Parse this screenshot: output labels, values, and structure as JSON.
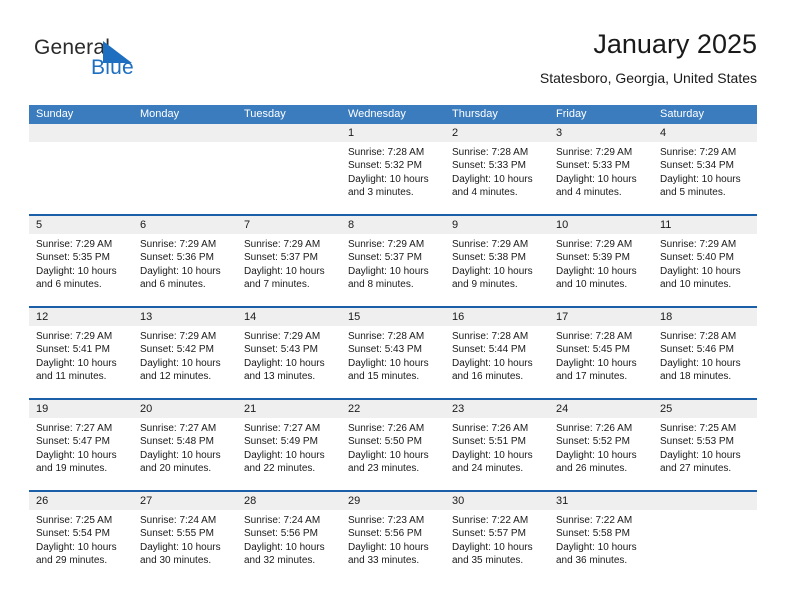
{
  "brand": {
    "name_part1": "General",
    "name_part2": "Blue",
    "triangle_color": "#1f6fc0",
    "text_color": "#2b2b2b"
  },
  "header": {
    "title": "January 2025",
    "subtitle": "Statesboro, Georgia, United States"
  },
  "theme": {
    "header_bar": "#3b7cbe",
    "row_divider": "#1b5fa8",
    "date_band": "#efefef",
    "text": "#1a1a1a"
  },
  "weekdays": [
    "Sunday",
    "Monday",
    "Tuesday",
    "Wednesday",
    "Thursday",
    "Friday",
    "Saturday"
  ],
  "weeks": [
    [
      {
        "day": "",
        "sunrise": "",
        "sunset": "",
        "daylight": "",
        "daylight2": "",
        "empty": true
      },
      {
        "day": "",
        "sunrise": "",
        "sunset": "",
        "daylight": "",
        "daylight2": "",
        "empty": true
      },
      {
        "day": "",
        "sunrise": "",
        "sunset": "",
        "daylight": "",
        "daylight2": "",
        "empty": true
      },
      {
        "day": "1",
        "sunrise": "Sunrise: 7:28 AM",
        "sunset": "Sunset: 5:32 PM",
        "daylight": "Daylight: 10 hours",
        "daylight2": "and 3 minutes.",
        "empty": false
      },
      {
        "day": "2",
        "sunrise": "Sunrise: 7:28 AM",
        "sunset": "Sunset: 5:33 PM",
        "daylight": "Daylight: 10 hours",
        "daylight2": "and 4 minutes.",
        "empty": false
      },
      {
        "day": "3",
        "sunrise": "Sunrise: 7:29 AM",
        "sunset": "Sunset: 5:33 PM",
        "daylight": "Daylight: 10 hours",
        "daylight2": "and 4 minutes.",
        "empty": false
      },
      {
        "day": "4",
        "sunrise": "Sunrise: 7:29 AM",
        "sunset": "Sunset: 5:34 PM",
        "daylight": "Daylight: 10 hours",
        "daylight2": "and 5 minutes.",
        "empty": false
      }
    ],
    [
      {
        "day": "5",
        "sunrise": "Sunrise: 7:29 AM",
        "sunset": "Sunset: 5:35 PM",
        "daylight": "Daylight: 10 hours",
        "daylight2": "and 6 minutes.",
        "empty": false
      },
      {
        "day": "6",
        "sunrise": "Sunrise: 7:29 AM",
        "sunset": "Sunset: 5:36 PM",
        "daylight": "Daylight: 10 hours",
        "daylight2": "and 6 minutes.",
        "empty": false
      },
      {
        "day": "7",
        "sunrise": "Sunrise: 7:29 AM",
        "sunset": "Sunset: 5:37 PM",
        "daylight": "Daylight: 10 hours",
        "daylight2": "and 7 minutes.",
        "empty": false
      },
      {
        "day": "8",
        "sunrise": "Sunrise: 7:29 AM",
        "sunset": "Sunset: 5:37 PM",
        "daylight": "Daylight: 10 hours",
        "daylight2": "and 8 minutes.",
        "empty": false
      },
      {
        "day": "9",
        "sunrise": "Sunrise: 7:29 AM",
        "sunset": "Sunset: 5:38 PM",
        "daylight": "Daylight: 10 hours",
        "daylight2": "and 9 minutes.",
        "empty": false
      },
      {
        "day": "10",
        "sunrise": "Sunrise: 7:29 AM",
        "sunset": "Sunset: 5:39 PM",
        "daylight": "Daylight: 10 hours",
        "daylight2": "and 10 minutes.",
        "empty": false
      },
      {
        "day": "11",
        "sunrise": "Sunrise: 7:29 AM",
        "sunset": "Sunset: 5:40 PM",
        "daylight": "Daylight: 10 hours",
        "daylight2": "and 10 minutes.",
        "empty": false
      }
    ],
    [
      {
        "day": "12",
        "sunrise": "Sunrise: 7:29 AM",
        "sunset": "Sunset: 5:41 PM",
        "daylight": "Daylight: 10 hours",
        "daylight2": "and 11 minutes.",
        "empty": false
      },
      {
        "day": "13",
        "sunrise": "Sunrise: 7:29 AM",
        "sunset": "Sunset: 5:42 PM",
        "daylight": "Daylight: 10 hours",
        "daylight2": "and 12 minutes.",
        "empty": false
      },
      {
        "day": "14",
        "sunrise": "Sunrise: 7:29 AM",
        "sunset": "Sunset: 5:43 PM",
        "daylight": "Daylight: 10 hours",
        "daylight2": "and 13 minutes.",
        "empty": false
      },
      {
        "day": "15",
        "sunrise": "Sunrise: 7:28 AM",
        "sunset": "Sunset: 5:43 PM",
        "daylight": "Daylight: 10 hours",
        "daylight2": "and 15 minutes.",
        "empty": false
      },
      {
        "day": "16",
        "sunrise": "Sunrise: 7:28 AM",
        "sunset": "Sunset: 5:44 PM",
        "daylight": "Daylight: 10 hours",
        "daylight2": "and 16 minutes.",
        "empty": false
      },
      {
        "day": "17",
        "sunrise": "Sunrise: 7:28 AM",
        "sunset": "Sunset: 5:45 PM",
        "daylight": "Daylight: 10 hours",
        "daylight2": "and 17 minutes.",
        "empty": false
      },
      {
        "day": "18",
        "sunrise": "Sunrise: 7:28 AM",
        "sunset": "Sunset: 5:46 PM",
        "daylight": "Daylight: 10 hours",
        "daylight2": "and 18 minutes.",
        "empty": false
      }
    ],
    [
      {
        "day": "19",
        "sunrise": "Sunrise: 7:27 AM",
        "sunset": "Sunset: 5:47 PM",
        "daylight": "Daylight: 10 hours",
        "daylight2": "and 19 minutes.",
        "empty": false
      },
      {
        "day": "20",
        "sunrise": "Sunrise: 7:27 AM",
        "sunset": "Sunset: 5:48 PM",
        "daylight": "Daylight: 10 hours",
        "daylight2": "and 20 minutes.",
        "empty": false
      },
      {
        "day": "21",
        "sunrise": "Sunrise: 7:27 AM",
        "sunset": "Sunset: 5:49 PM",
        "daylight": "Daylight: 10 hours",
        "daylight2": "and 22 minutes.",
        "empty": false
      },
      {
        "day": "22",
        "sunrise": "Sunrise: 7:26 AM",
        "sunset": "Sunset: 5:50 PM",
        "daylight": "Daylight: 10 hours",
        "daylight2": "and 23 minutes.",
        "empty": false
      },
      {
        "day": "23",
        "sunrise": "Sunrise: 7:26 AM",
        "sunset": "Sunset: 5:51 PM",
        "daylight": "Daylight: 10 hours",
        "daylight2": "and 24 minutes.",
        "empty": false
      },
      {
        "day": "24",
        "sunrise": "Sunrise: 7:26 AM",
        "sunset": "Sunset: 5:52 PM",
        "daylight": "Daylight: 10 hours",
        "daylight2": "and 26 minutes.",
        "empty": false
      },
      {
        "day": "25",
        "sunrise": "Sunrise: 7:25 AM",
        "sunset": "Sunset: 5:53 PM",
        "daylight": "Daylight: 10 hours",
        "daylight2": "and 27 minutes.",
        "empty": false
      }
    ],
    [
      {
        "day": "26",
        "sunrise": "Sunrise: 7:25 AM",
        "sunset": "Sunset: 5:54 PM",
        "daylight": "Daylight: 10 hours",
        "daylight2": "and 29 minutes.",
        "empty": false
      },
      {
        "day": "27",
        "sunrise": "Sunrise: 7:24 AM",
        "sunset": "Sunset: 5:55 PM",
        "daylight": "Daylight: 10 hours",
        "daylight2": "and 30 minutes.",
        "empty": false
      },
      {
        "day": "28",
        "sunrise": "Sunrise: 7:24 AM",
        "sunset": "Sunset: 5:56 PM",
        "daylight": "Daylight: 10 hours",
        "daylight2": "and 32 minutes.",
        "empty": false
      },
      {
        "day": "29",
        "sunrise": "Sunrise: 7:23 AM",
        "sunset": "Sunset: 5:56 PM",
        "daylight": "Daylight: 10 hours",
        "daylight2": "and 33 minutes.",
        "empty": false
      },
      {
        "day": "30",
        "sunrise": "Sunrise: 7:22 AM",
        "sunset": "Sunset: 5:57 PM",
        "daylight": "Daylight: 10 hours",
        "daylight2": "and 35 minutes.",
        "empty": false
      },
      {
        "day": "31",
        "sunrise": "Sunrise: 7:22 AM",
        "sunset": "Sunset: 5:58 PM",
        "daylight": "Daylight: 10 hours",
        "daylight2": "and 36 minutes.",
        "empty": false
      },
      {
        "day": "",
        "sunrise": "",
        "sunset": "",
        "daylight": "",
        "daylight2": "",
        "empty": true
      }
    ]
  ]
}
